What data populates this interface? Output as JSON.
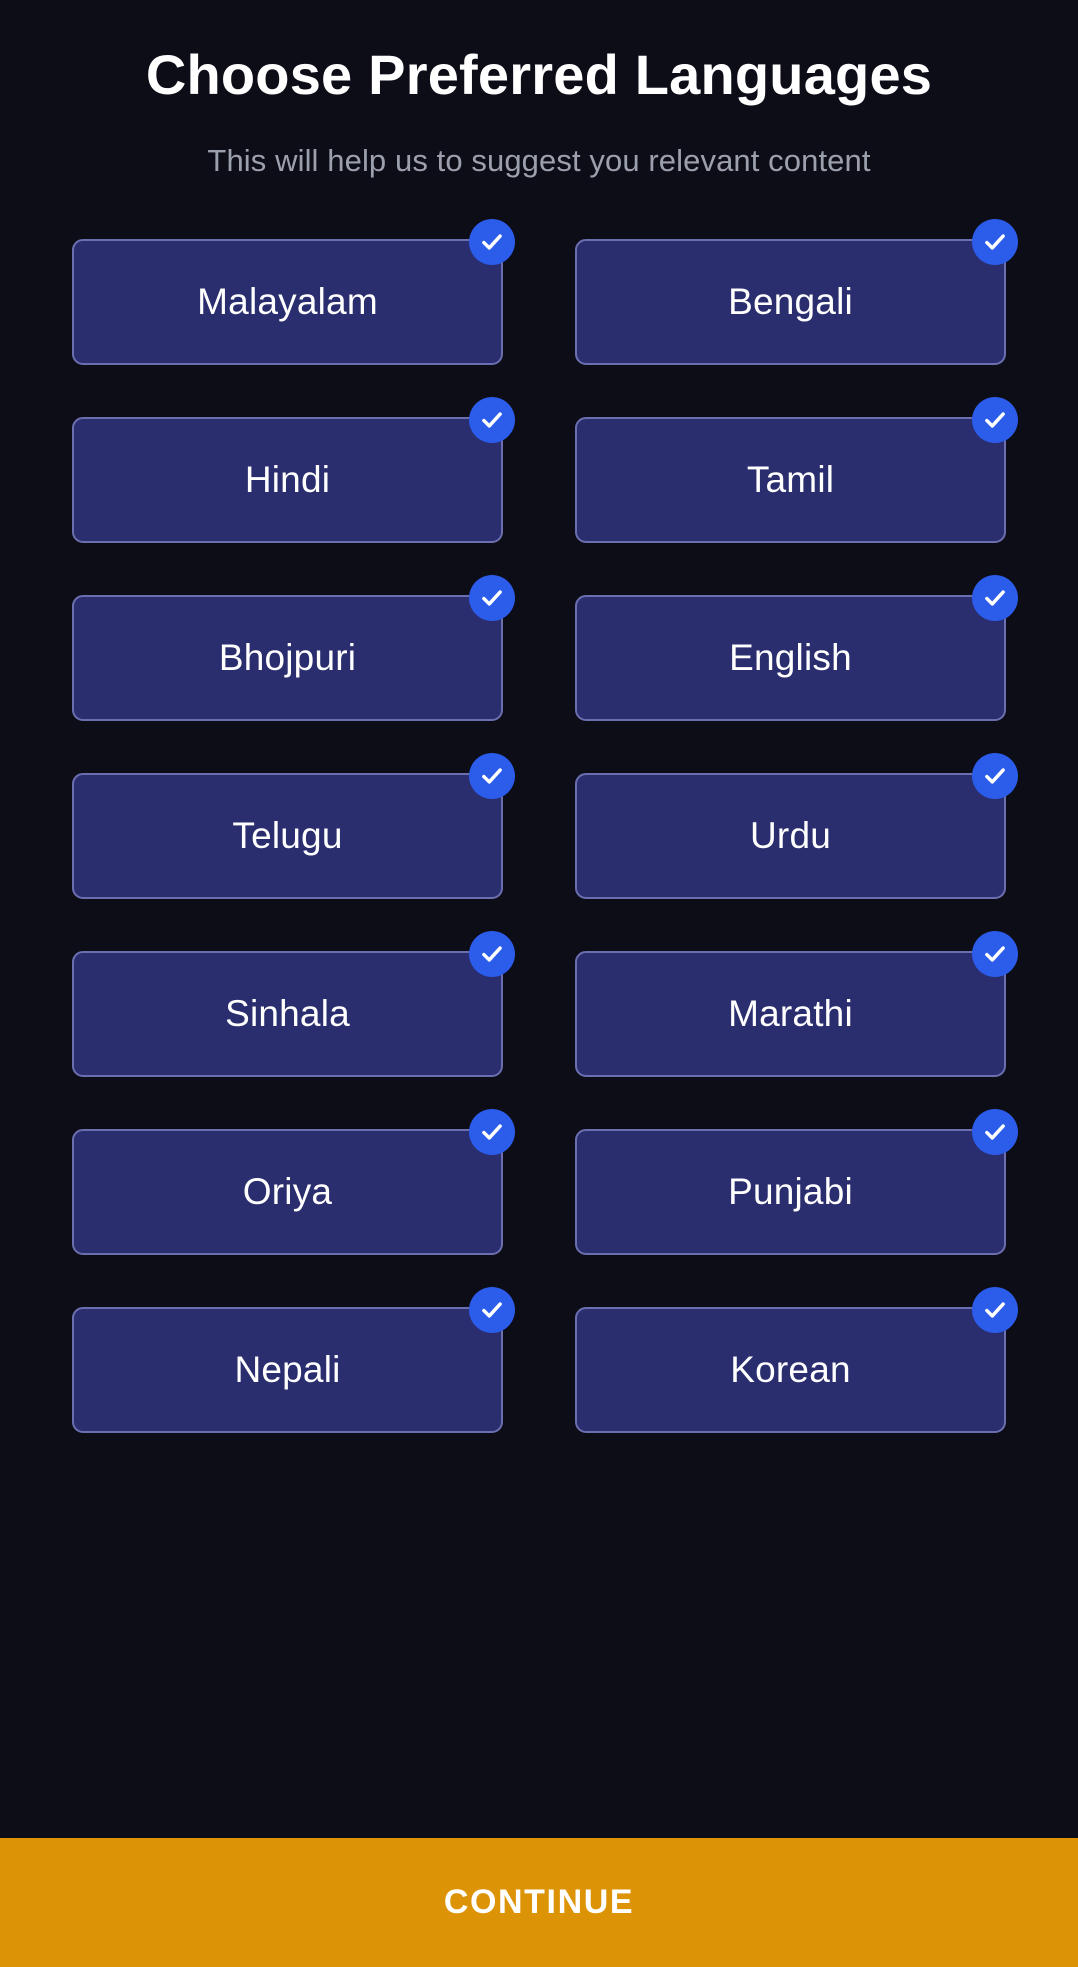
{
  "header": {
    "title": "Choose Preferred Languages",
    "subtitle": "This will help us to suggest you relevant content"
  },
  "languages": [
    {
      "label": "Malayalam",
      "selected": true
    },
    {
      "label": "Bengali",
      "selected": true
    },
    {
      "label": "Hindi",
      "selected": true
    },
    {
      "label": "Tamil",
      "selected": true
    },
    {
      "label": "Bhojpuri",
      "selected": true
    },
    {
      "label": "English",
      "selected": true
    },
    {
      "label": "Telugu",
      "selected": true
    },
    {
      "label": "Urdu",
      "selected": true
    },
    {
      "label": "Sinhala",
      "selected": true
    },
    {
      "label": "Marathi",
      "selected": true
    },
    {
      "label": "Oriya",
      "selected": true
    },
    {
      "label": "Punjabi",
      "selected": true
    },
    {
      "label": "Nepali",
      "selected": true
    },
    {
      "label": "Korean",
      "selected": true
    }
  ],
  "footer": {
    "continue_label": "CONTINUE"
  },
  "icons": {
    "selected_badge": "check-circle-icon"
  },
  "colors": {
    "background": "#0d0d18",
    "card_fill": "#2a2d6e",
    "card_border": "#6b6faf",
    "badge_blue": "#2b5cea",
    "continue_amber": "#dd9306",
    "title_text": "#ffffff",
    "subtitle_text": "#9ca0ad"
  }
}
